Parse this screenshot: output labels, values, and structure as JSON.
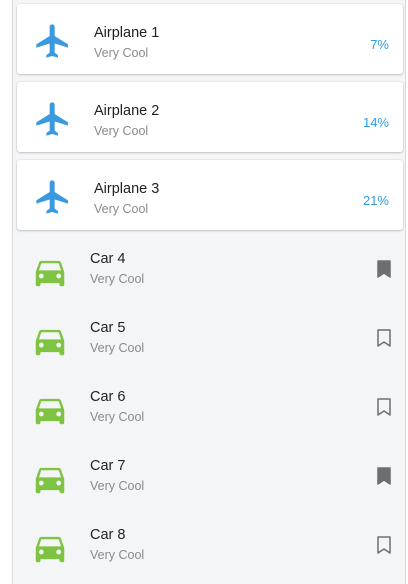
{
  "items": [
    {
      "kind": "airplane",
      "title": "Airplane 1",
      "subtitle": "Very Cool",
      "percent": "7%",
      "icon": "airplane-icon",
      "color": "#3b99e0"
    },
    {
      "kind": "airplane",
      "title": "Airplane 2",
      "subtitle": "Very Cool",
      "percent": "14%",
      "icon": "airplane-icon",
      "color": "#3b99e0"
    },
    {
      "kind": "airplane",
      "title": "Airplane 3",
      "subtitle": "Very Cool",
      "percent": "21%",
      "icon": "airplane-icon",
      "color": "#3b99e0"
    },
    {
      "kind": "car",
      "title": "Car 4",
      "subtitle": "Very Cool",
      "bookmarked": true,
      "icon": "car-icon",
      "color": "#7ec341"
    },
    {
      "kind": "car",
      "title": "Car 5",
      "subtitle": "Very Cool",
      "bookmarked": false,
      "icon": "car-icon",
      "color": "#7ec341"
    },
    {
      "kind": "car",
      "title": "Car 6",
      "subtitle": "Very Cool",
      "bookmarked": false,
      "icon": "car-icon",
      "color": "#7ec341"
    },
    {
      "kind": "car",
      "title": "Car 7",
      "subtitle": "Very Cool",
      "bookmarked": true,
      "icon": "car-icon",
      "color": "#7ec341"
    },
    {
      "kind": "car",
      "title": "Car 8",
      "subtitle": "Very Cool",
      "bookmarked": false,
      "icon": "car-icon",
      "color": "#7ec341"
    }
  ],
  "colors": {
    "accent": "#2d9be3",
    "car": "#7ec341",
    "bookmark": "#6e6e6e"
  }
}
